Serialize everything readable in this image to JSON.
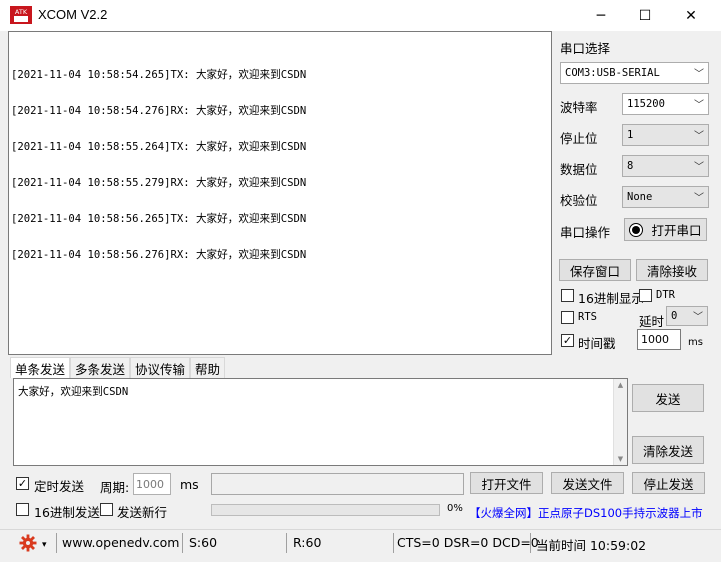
{
  "window": {
    "title": "XCOM V2.2",
    "icon_text": "ATK"
  },
  "output": {
    "lines": [
      "[2021-11-04 10:58:54.265]TX: 大家好，欢迎来到CSDN",
      "[2021-11-04 10:58:54.276]RX: 大家好，欢迎来到CSDN",
      "[2021-11-04 10:58:55.264]TX: 大家好，欢迎来到CSDN",
      "[2021-11-04 10:58:55.279]RX: 大家好，欢迎来到CSDN",
      "[2021-11-04 10:58:56.265]TX: 大家好，欢迎来到CSDN",
      "[2021-11-04 10:58:56.276]RX: 大家好，欢迎来到CSDN"
    ]
  },
  "settings": {
    "port_select_label": "串口选择",
    "port_value": "COM3:USB-SERIAL",
    "baud_label": "波特率",
    "baud_value": "115200",
    "stopbits_label": "停止位",
    "stopbits_value": "1",
    "databits_label": "数据位",
    "databits_value": "8",
    "parity_label": "校验位",
    "parity_value": "None",
    "port_op_label": "串口操作",
    "open_port_label": "打开串口",
    "save_window_label": "保存窗口",
    "clear_recv_label": "清除接收",
    "hex_display_label": "16进制显示",
    "hex_display_checked": false,
    "dtr_label": "DTR",
    "dtr_checked": false,
    "rts_label": "RTS",
    "rts_checked": false,
    "delay_label": "延时",
    "delay_value": "0",
    "timestamp_label": "时间戳",
    "timestamp_checked": true,
    "timestamp_ms_value": "1000",
    "timestamp_unit": "ms"
  },
  "tabs": [
    "单条发送",
    "多条发送",
    "协议传输",
    "帮助"
  ],
  "send": {
    "text": "大家好，欢迎来到CSDN",
    "send_label": "发送",
    "clear_send_label": "清除发送",
    "timed_send_label": "定时发送",
    "timed_send_checked": true,
    "period_label": "周期:",
    "period_value": "1000",
    "period_unit": "ms",
    "open_file_label": "打开文件",
    "send_file_label": "发送文件",
    "stop_send_label": "停止发送",
    "hex_send_label": "16进制发送",
    "hex_send_checked": false,
    "send_newline_label": "发送新行",
    "send_newline_checked": false,
    "progress_percent": 0,
    "progress_text": "0%",
    "ad_text": "【火爆全网】正点原子DS100手持示波器上市"
  },
  "status": {
    "website": "www.openedv.com",
    "s_count": "S:60",
    "r_count": "R:60",
    "lines": "CTS=0 DSR=0 DCD=0",
    "time": "当前时间 10:59:02"
  },
  "colors": {
    "ad": "#0000ff",
    "gear": "#d93a1e"
  }
}
